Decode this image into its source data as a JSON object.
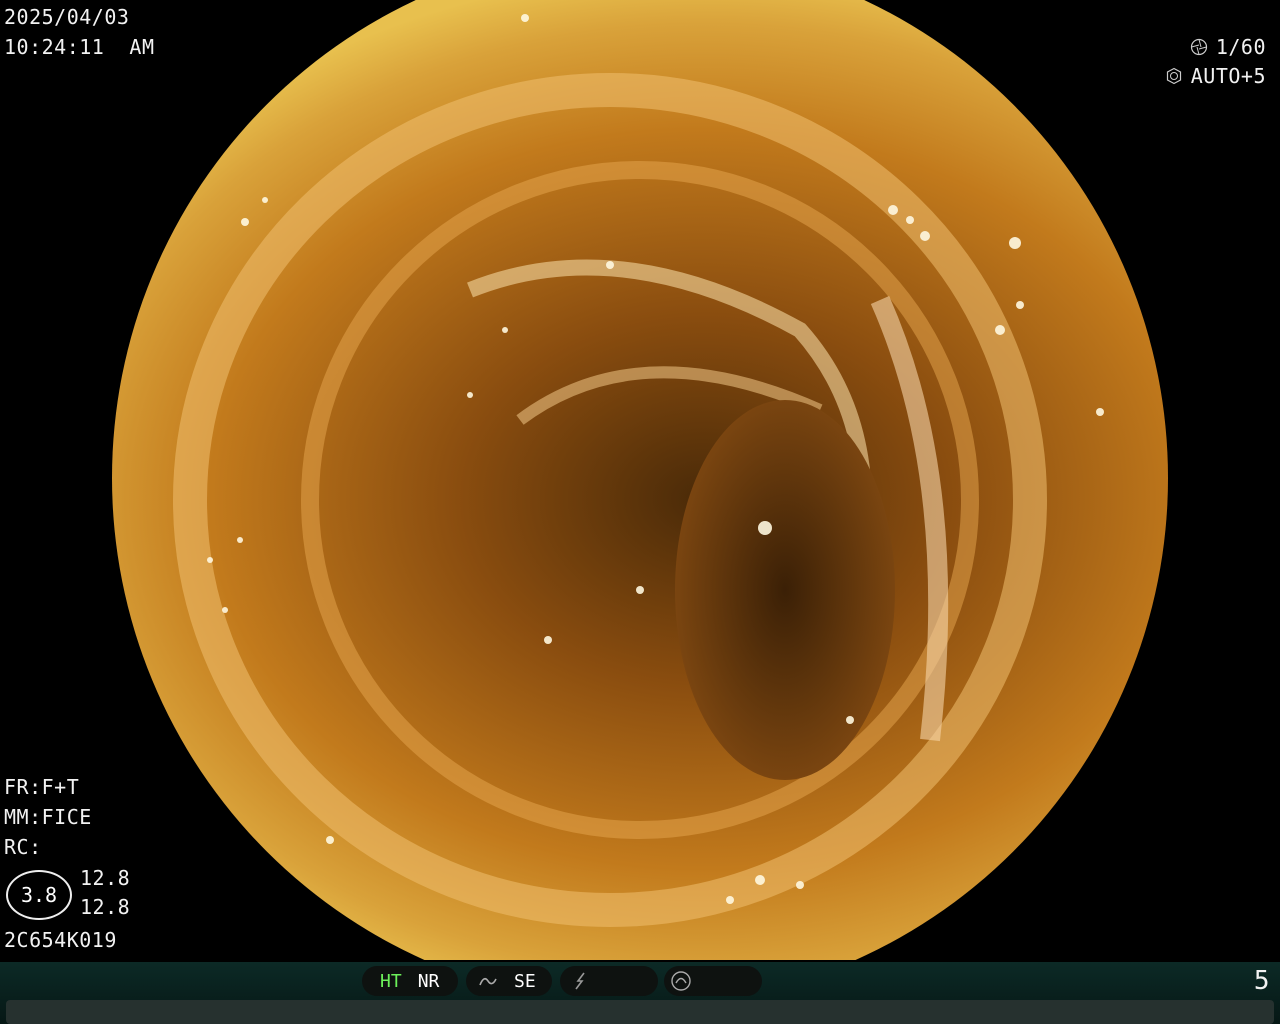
{
  "header": {
    "date": "2025/04/03",
    "time": "10:24:11  AM"
  },
  "top_right": {
    "shutter_icon": "shutter-icon",
    "shutter": "1/60",
    "iris_icon": "iris-icon",
    "exposure": "AUTO+5"
  },
  "settings": {
    "fr": "FR:F+T",
    "mm": "MM:FICE",
    "rc": "RC:"
  },
  "gauge": {
    "value": "3.8",
    "top": "12.8",
    "bottom": "12.8"
  },
  "serial": "2C654K019",
  "status_bar": {
    "ht": "HT",
    "nr": "NR",
    "se": "SE",
    "icons": [
      "wave-icon",
      "flash-icon",
      "dial-icon"
    ],
    "page": "5",
    "ht_color": "#6cf05a"
  }
}
